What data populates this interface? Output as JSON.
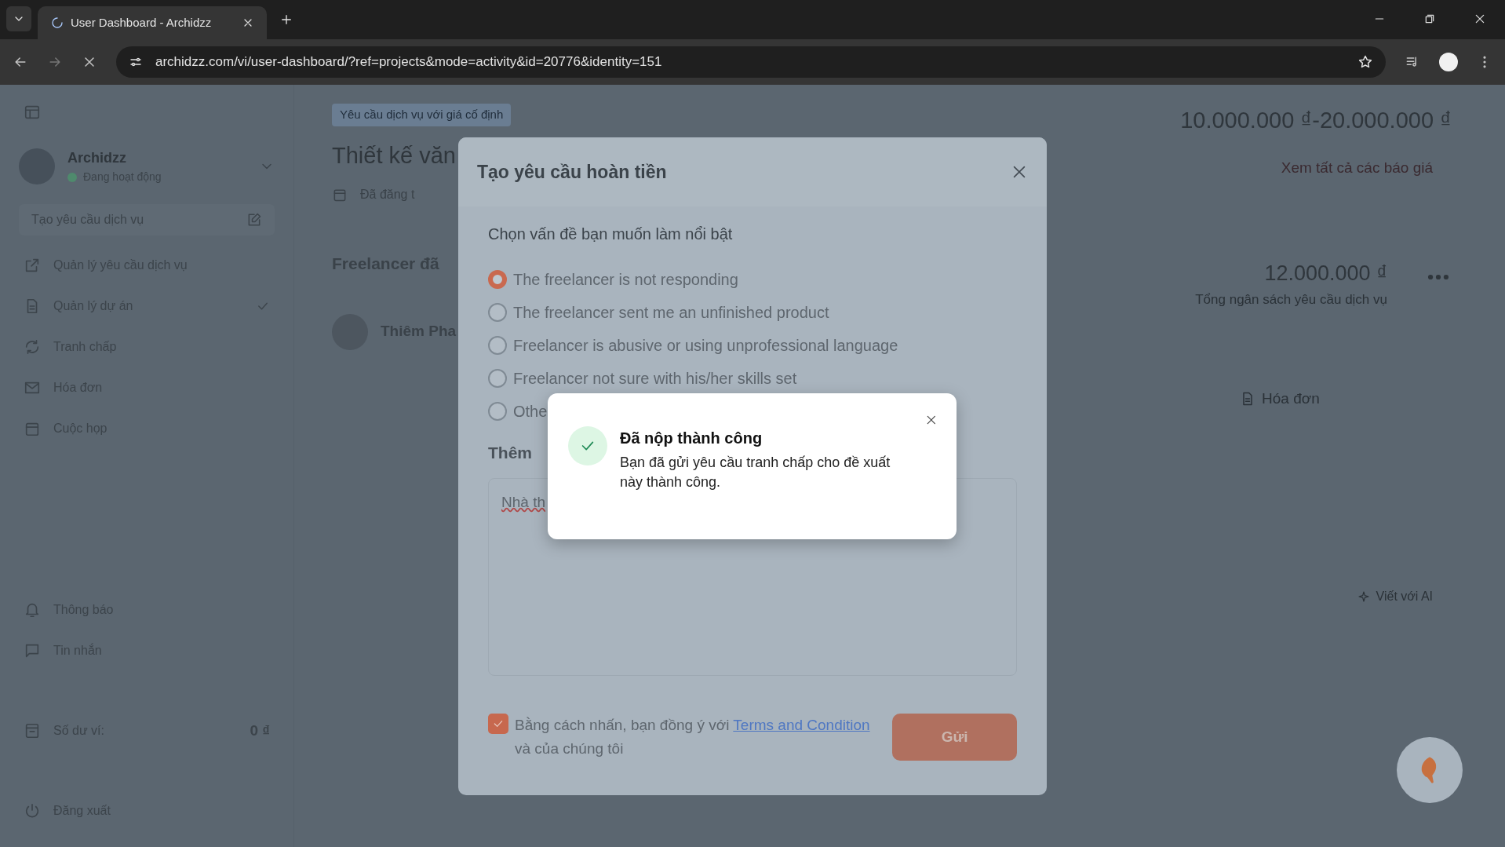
{
  "browser": {
    "tab_title": "User Dashboard - Archidzz",
    "url": "archidzz.com/vi/user-dashboard/?ref=projects&mode=activity&id=20776&identity=151"
  },
  "sidebar": {
    "account": {
      "name": "Archidzz",
      "status": "Đang hoạt động",
      "online": true
    },
    "create_request": "Tạo yêu cầu dịch vụ",
    "menu": [
      {
        "label": "Quản lý yêu cầu dịch vụ"
      },
      {
        "label": "Quản lý dự án"
      },
      {
        "label": "Tranh chấp"
      },
      {
        "label": "Hóa đơn"
      },
      {
        "label": "Cuộc họp"
      }
    ],
    "bottom": [
      {
        "label": "Thông báo"
      },
      {
        "label": "Tin nhắn"
      }
    ],
    "wallet": {
      "label": "Số dư ví:",
      "amount": "0 ₫"
    },
    "logout": "Đăng xuất"
  },
  "project": {
    "tag": "Yêu cầu dịch vụ với giá cố định",
    "title": "Thiết kế văn",
    "posted": "Đã đăng t",
    "freelancer_heading": "Freelancer đã",
    "freelancer_name": "Thiêm Pha",
    "price_range": "10.000.000 ₫-20.000.000 ₫",
    "quotes_link": "Xem tất cả các báo giá",
    "budget": "12.000.000 ₫",
    "budget_label": "Tổng ngân sách yêu cầu dịch vụ",
    "invoice_tab": "Hóa đơn",
    "ai_button": "Viết với AI"
  },
  "refund_modal": {
    "title": "Tạo yêu cầu hoàn tiền",
    "prompt": "Chọn vấn đề bạn muốn làm nổi bật",
    "options": [
      {
        "label": "The freelancer is not responding",
        "selected": true
      },
      {
        "label": "The freelancer sent me an unfinished product",
        "selected": false
      },
      {
        "label": "Freelancer is abusive or using unprofessional language",
        "selected": false
      },
      {
        "label": "Freelancer not sure with his/her skills set",
        "selected": false
      },
      {
        "label": "Othe",
        "selected": false
      }
    ],
    "details_label": "Thêm",
    "details_value": "Nhà th",
    "agree": {
      "checked": true,
      "text_before": "Bằng cách nhấn, bạn đồng ý với",
      "link": "Terms and Condition",
      "text_after": "và của chúng tôi"
    },
    "submit": "Gửi"
  },
  "toast": {
    "title": "Đã nộp thành công",
    "message": "Bạn đã gửi yêu cầu tranh chấp cho đề xuất này thành công."
  }
}
